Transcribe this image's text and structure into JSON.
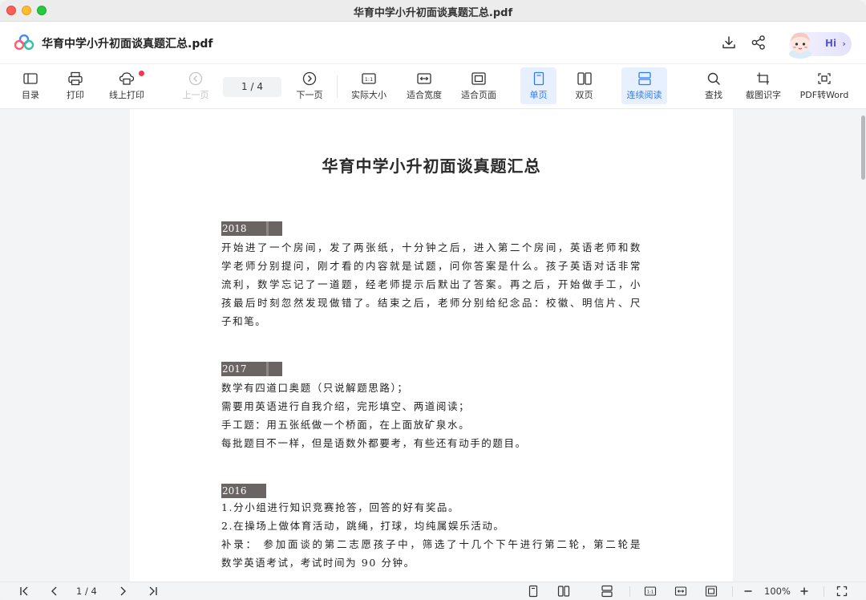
{
  "window": {
    "title": "华育中学小升初面谈真题汇总.pdf"
  },
  "header": {
    "doc_name": "华育中学小升初面谈真题汇总.pdf",
    "assistant_label": "Hi"
  },
  "toolbar": {
    "toc": "目录",
    "print": "打印",
    "online_print": "线上打印",
    "prev_page": "上一页",
    "page_indicator": "1 / 4",
    "next_page": "下一页",
    "actual_size": "实际大小",
    "fit_width": "适合宽度",
    "fit_page": "适合页面",
    "single_page": "单页",
    "double_page": "双页",
    "continuous": "连续阅读",
    "search": "查找",
    "screenshot_ocr": "截图识字",
    "pdf_to_word": "PDF转Word",
    "active_color": "#2f7bf5"
  },
  "document": {
    "title": "华育中学小升初面谈真题汇总",
    "sections": [
      {
        "year": "2018 年：",
        "lines": [
          "开始进了一个房间，发了两张纸，十分钟之后，进入第二个房间，英语老师和数",
          "学老师分别提问，刚才看的内容就是试题，问你答案是什么。孩子英语对话非常",
          "流利，数学忘记了一道题，经老师提示后默出了答案。再之后，开始做手工，小",
          "孩最后时刻忽然发现做错了。结束之后，老师分别给纪念品：校徽、明信片、尺",
          "子和笔。"
        ]
      },
      {
        "year": "2017 年：",
        "lines": [
          "数学有四道口奥题（只说解题思路）；",
          "需要用英语进行自我介绍，完形填空、两道阅读；",
          "手工题：用五张纸做一个桥面，在上面放矿泉水。",
          "每批题目不一样，但是语数外都要考，有些还有动手的题目。"
        ]
      },
      {
        "year": "2016 年：",
        "lines": [
          "1.分小组进行知识竞赛抢答，回答的好有奖品。",
          "2.在操场上做体育活动，跳绳，打球，均纯属娱乐活动。",
          "补录： 参加面谈的第二志愿孩子中，筛选了十几个下午进行第二轮，第二轮是",
          "数学英语考试，考试时间为 90 分钟。"
        ]
      }
    ]
  },
  "bottombar": {
    "page_indicator": "1 / 4",
    "zoom": "100%"
  }
}
